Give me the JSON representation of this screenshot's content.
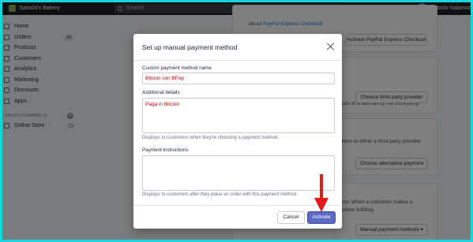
{
  "topbar": {
    "store_name": "Satoshi's Bakery",
    "search_placeholder": "Search",
    "user_initials": "SN",
    "user_name": "Satoshi Nalamot"
  },
  "sidebar": {
    "items": [
      {
        "label": "Home",
        "icon": "home-icon"
      },
      {
        "label": "Orders",
        "icon": "orders-icon",
        "badge": "19"
      },
      {
        "label": "Products",
        "icon": "tag-icon"
      },
      {
        "label": "Customers",
        "icon": "person-icon"
      },
      {
        "label": "Analytics",
        "icon": "chart-icon"
      },
      {
        "label": "Marketing",
        "icon": "megaphone-icon"
      },
      {
        "label": "Discounts",
        "icon": "discount-icon"
      },
      {
        "label": "Apps",
        "icon": "apps-icon"
      }
    ],
    "channels_heading": "SALES CHANNELS",
    "online_store": "Online Store"
  },
  "background": {
    "paypal_text": "about",
    "paypal_link": "PayPal Express Checkout",
    "paypal_button": "Activate PayPal Express Checkout",
    "third_party_text": "thods at a rate set by the third-party.",
    "third_party_button": "Choose third-party provider",
    "alternative_text": "ddition to either a third-party provider",
    "alternative_button": "Choose alternative payment",
    "manual_text_1": "store. When a customer makes a",
    "manual_text_2": "r before fulfilling.",
    "manual_button": "Manual payment methods"
  },
  "modal": {
    "title": "Set up manual payment method",
    "name_label": "Custom payment method name",
    "name_value": "Bitcoin con BPay",
    "details_label": "Additional details",
    "details_value": "Paga in Bitcoin",
    "details_help": "Displays to customers when they're choosing a payment method.",
    "instructions_label": "Payment instructions",
    "instructions_value": "",
    "instructions_help": "Displays to customers after they place an order with this payment method.",
    "cancel_label": "Cancel",
    "activate_label": "Activate"
  },
  "colors": {
    "border_frame": "#1ad3e0",
    "primary_button": "#5c6ac4",
    "input_text": "#bf0711",
    "arrow": "#e31b1b"
  }
}
